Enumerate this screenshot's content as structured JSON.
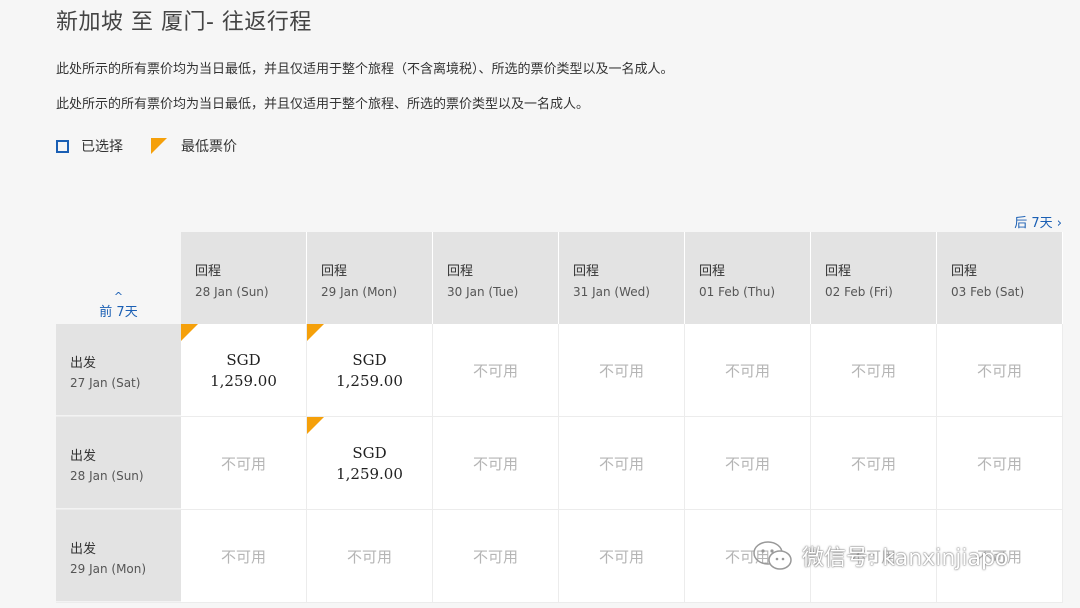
{
  "title": "新加坡 至 厦门- 往返行程",
  "notes": [
    "此处所示的所有票价均为当日最低，并且仅适用于整个旅程（不含离境税）、所选的票价类型以及一名成人。",
    "此处所示的所有票价均为当日最低，并且仅适用于整个旅程、所选的票价类型以及一名成人。"
  ],
  "legend": {
    "selected": "已选择",
    "lowest": "最低票价"
  },
  "nav": {
    "prev": "前 7天",
    "next": "后 7天 ›"
  },
  "return_label": "回程",
  "depart_label": "出发",
  "unavailable": "不可用",
  "columns": [
    "28 Jan (Sun)",
    "29 Jan (Mon)",
    "30 Jan (Tue)",
    "31 Jan (Wed)",
    "01 Feb (Thu)",
    "02 Feb (Fri)",
    "03 Feb (Sat)"
  ],
  "rows": [
    {
      "date": "27 Jan (Sat)",
      "cells": [
        {
          "currency": "SGD",
          "amount": "1,259.00",
          "lowest": true
        },
        {
          "currency": "SGD",
          "amount": "1,259.00",
          "lowest": true
        },
        null,
        null,
        null,
        null,
        null
      ]
    },
    {
      "date": "28 Jan (Sun)",
      "cells": [
        null,
        {
          "currency": "SGD",
          "amount": "1,259.00",
          "lowest": true
        },
        null,
        null,
        null,
        null,
        null
      ]
    },
    {
      "date": "29 Jan (Mon)",
      "cells": [
        null,
        null,
        null,
        null,
        null,
        null,
        null
      ]
    }
  ],
  "colors": {
    "accent": "#1a5fb4",
    "lowest": "#f5a00a",
    "header_bg": "#e3e3e3"
  },
  "watermark": "微信号: kanxinjiapo"
}
